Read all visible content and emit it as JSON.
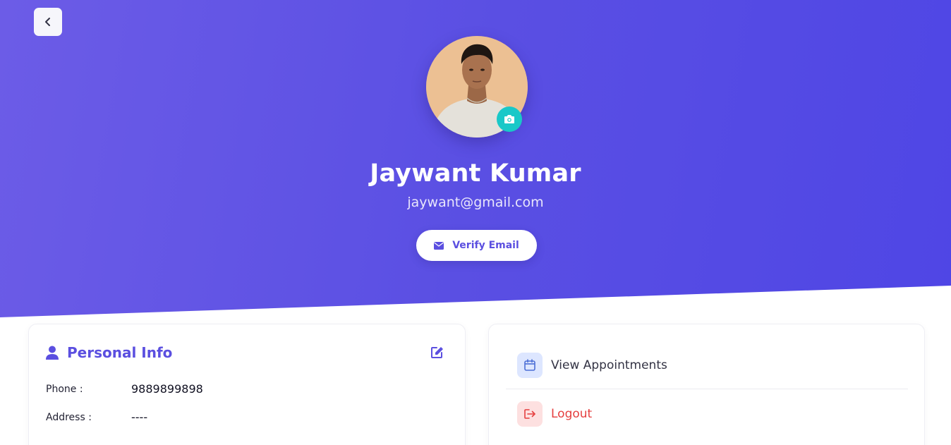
{
  "profile": {
    "name": "Jaywant Kumar",
    "email": "jaywant@gmail.com",
    "verify_label": "Verify Email"
  },
  "personal_info": {
    "title": "Personal Info",
    "fields": [
      {
        "label": "Phone :",
        "value": "9889899898"
      },
      {
        "label": "Address :",
        "value": "----"
      }
    ]
  },
  "menu": {
    "items": [
      {
        "label": "View Appointments",
        "icon": "calendar-icon"
      },
      {
        "label": "Logout",
        "icon": "logout-icon"
      }
    ]
  },
  "colors": {
    "primary": "#5b4fe0",
    "accent_teal": "#19c8c8",
    "danger": "#e53e3e",
    "calendar_icon_bg": "#dde6ff",
    "logout_icon_bg": "#fde0e0"
  }
}
